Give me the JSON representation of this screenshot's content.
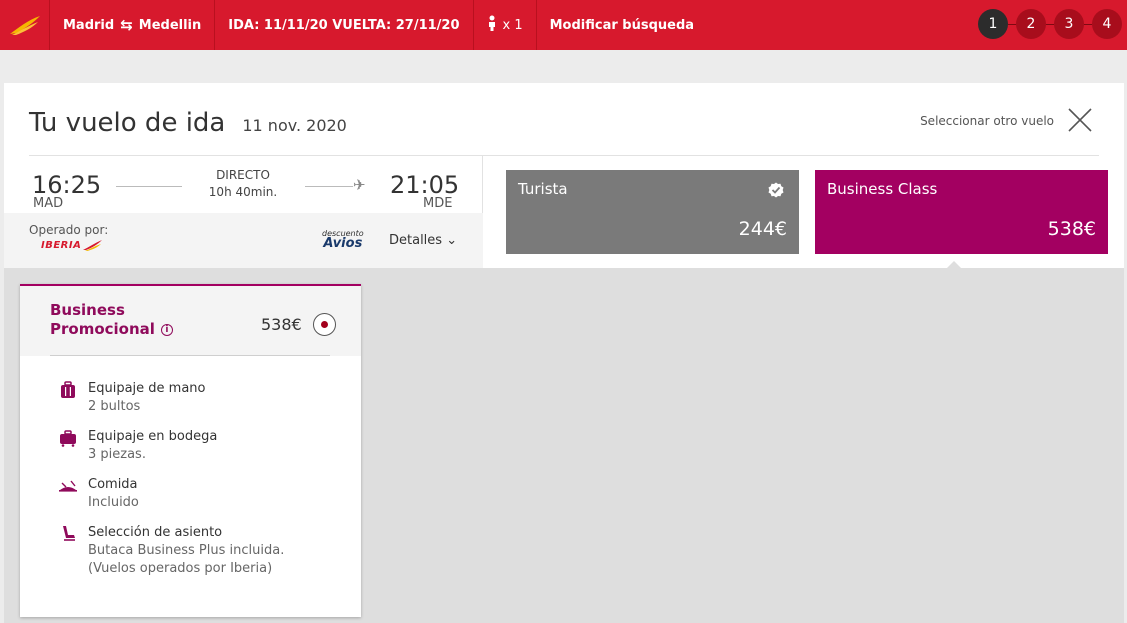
{
  "header": {
    "origin": "Madrid",
    "route_arrow": "⇆",
    "destination": "Medellin",
    "dates": "IDA: 11/11/20  VUELTA: 27/11/20",
    "passengers": "x 1",
    "modify": "Modificar búsqueda",
    "steps": [
      "1",
      "2",
      "3",
      "4"
    ],
    "active_step": 1
  },
  "flight": {
    "title": "Tu vuelo de ida",
    "date": "11 nov. 2020",
    "select_other": "Seleccionar otro vuelo",
    "departure_time": "16:25",
    "departure_code": "MAD",
    "arrival_time": "21:05",
    "arrival_code": "MDE",
    "type": "DIRECTO",
    "duration": "10h 40min.",
    "operated_by_label": "Operado por:",
    "operator": "IBERIA",
    "avios_small": "descuento",
    "avios_big": "Avios",
    "details": "Detalles ⌄"
  },
  "fares": [
    {
      "name": "Turista",
      "price": "244€",
      "color": "#7a7a7a",
      "icon": "check-badge-icon"
    },
    {
      "name": "Business Class",
      "price": "538€",
      "color": "#a30061",
      "selected": true
    }
  ],
  "fare_detail": {
    "name_line1": "Business",
    "name_line2": "Promocional",
    "info": "i",
    "price": "538€",
    "features": [
      {
        "icon": "hand-luggage-icon",
        "title": "Equipaje de mano",
        "desc": [
          "2 bultos"
        ]
      },
      {
        "icon": "checked-luggage-icon",
        "title": "Equipaje en bodega",
        "desc": [
          "3 piezas."
        ]
      },
      {
        "icon": "meal-icon",
        "title": "Comida",
        "desc": [
          "Incluido"
        ]
      },
      {
        "icon": "seat-icon",
        "title": "Selección de asiento",
        "desc": [
          "Butaca Business Plus incluida.",
          "(Vuelos operados por Iberia)"
        ]
      }
    ]
  },
  "colors": {
    "brand_red": "#d7192d",
    "business_purple": "#a30061",
    "turista_grey": "#7a7a7a"
  }
}
